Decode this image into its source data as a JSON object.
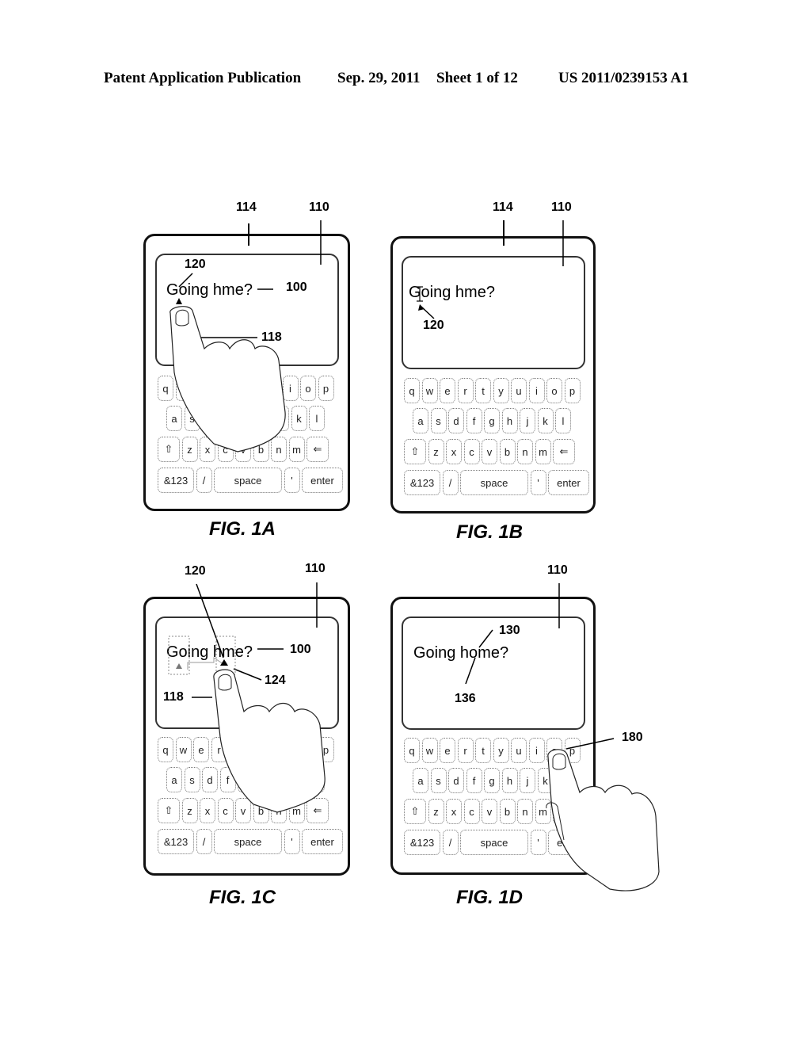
{
  "header": {
    "publication": "Patent Application Publication",
    "date": "Sep. 29, 2011",
    "sheet": "Sheet 1 of 12",
    "number": "US 2011/0239153 A1"
  },
  "keyboard": {
    "row1": [
      "q",
      "w",
      "e",
      "r",
      "t",
      "y",
      "u",
      "i",
      "o",
      "p"
    ],
    "row2": [
      "a",
      "s",
      "d",
      "f",
      "g",
      "h",
      "j",
      "k",
      "l"
    ],
    "row3": [
      "⇧",
      "z",
      "x",
      "c",
      "v",
      "b",
      "n",
      "m",
      "⇐"
    ],
    "row4": [
      "&123",
      "/",
      "space",
      "'",
      "enter"
    ]
  },
  "figures": [
    {
      "id": "1A",
      "caption": "FIG. 1A",
      "screen_text": "Going hme?",
      "refs": {
        "device": "114",
        "screen": "110",
        "cursor": "120",
        "text": "100",
        "finger": "118"
      }
    },
    {
      "id": "1B",
      "caption": "FIG. 1B",
      "screen_text": "Going hme?",
      "refs": {
        "device": "114",
        "screen": "110",
        "cursor": "120"
      }
    },
    {
      "id": "1C",
      "caption": "FIG. 1C",
      "screen_text": "Going hme?",
      "refs": {
        "screen": "110",
        "cursor": "120",
        "text": "100",
        "drag": "124",
        "finger": "118"
      }
    },
    {
      "id": "1D",
      "caption": "FIG. 1D",
      "screen_text": "Going home?",
      "refs": {
        "screen": "110",
        "inserted": "130",
        "cursor": "136",
        "finger": "180"
      }
    }
  ]
}
